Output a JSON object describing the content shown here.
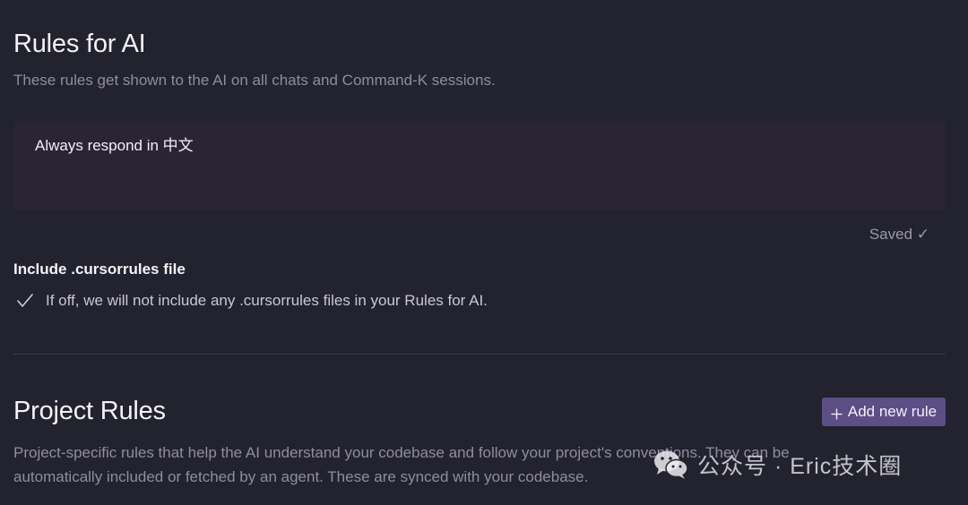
{
  "rules_for_ai": {
    "title": "Rules for AI",
    "description": "These rules get shown to the AI on all chats and Command-K sessions.",
    "rules_text": "Always respond in 中文",
    "save_status": "Saved ✓"
  },
  "cursorrules": {
    "heading": "Include .cursorrules file",
    "checked": true,
    "toggle_label": "If off, we will not include any .cursorrules files in your Rules for AI."
  },
  "project_rules": {
    "title": "Project Rules",
    "add_button_label": "Add new rule",
    "description_line1": "Project-specific rules that help the AI understand your codebase and follow your project's conventions. They can be",
    "description_line2": "automatically included or fetched by an agent. These are synced with your codebase."
  },
  "watermark": {
    "text": "公众号 · Eric技术圈"
  },
  "colors": {
    "background": "#23222f",
    "textarea_bg": "#2a2435",
    "accent_button": "#5b4f86",
    "muted_text": "#8f8d9e"
  }
}
